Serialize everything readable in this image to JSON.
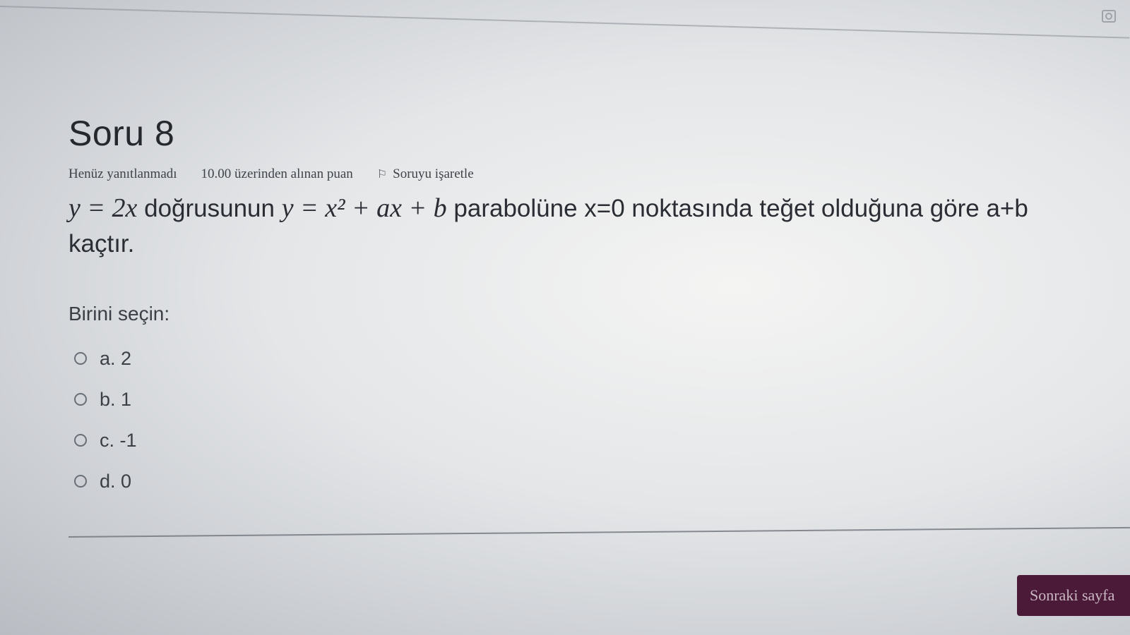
{
  "question": {
    "title": "Soru 8",
    "status": "Henüz yanıtlanmadı",
    "points": "10.00 üzerinden alınan puan",
    "flag_label": "Soruyu işaretle",
    "math_line": "y = 2x",
    "text_1": "doğrusunun",
    "math_parabola": "y = x² + ax + b",
    "text_2": "parabolüne x=0 noktasında teğet olduğuna göre a+b kaçtır."
  },
  "answer": {
    "prompt": "Birini seçin:",
    "options": [
      {
        "label": "a. 2"
      },
      {
        "label": "b. 1"
      },
      {
        "label": "c. -1"
      },
      {
        "label": "d. 0"
      }
    ]
  },
  "navigation": {
    "next_label": "Sonraki sayfa"
  }
}
